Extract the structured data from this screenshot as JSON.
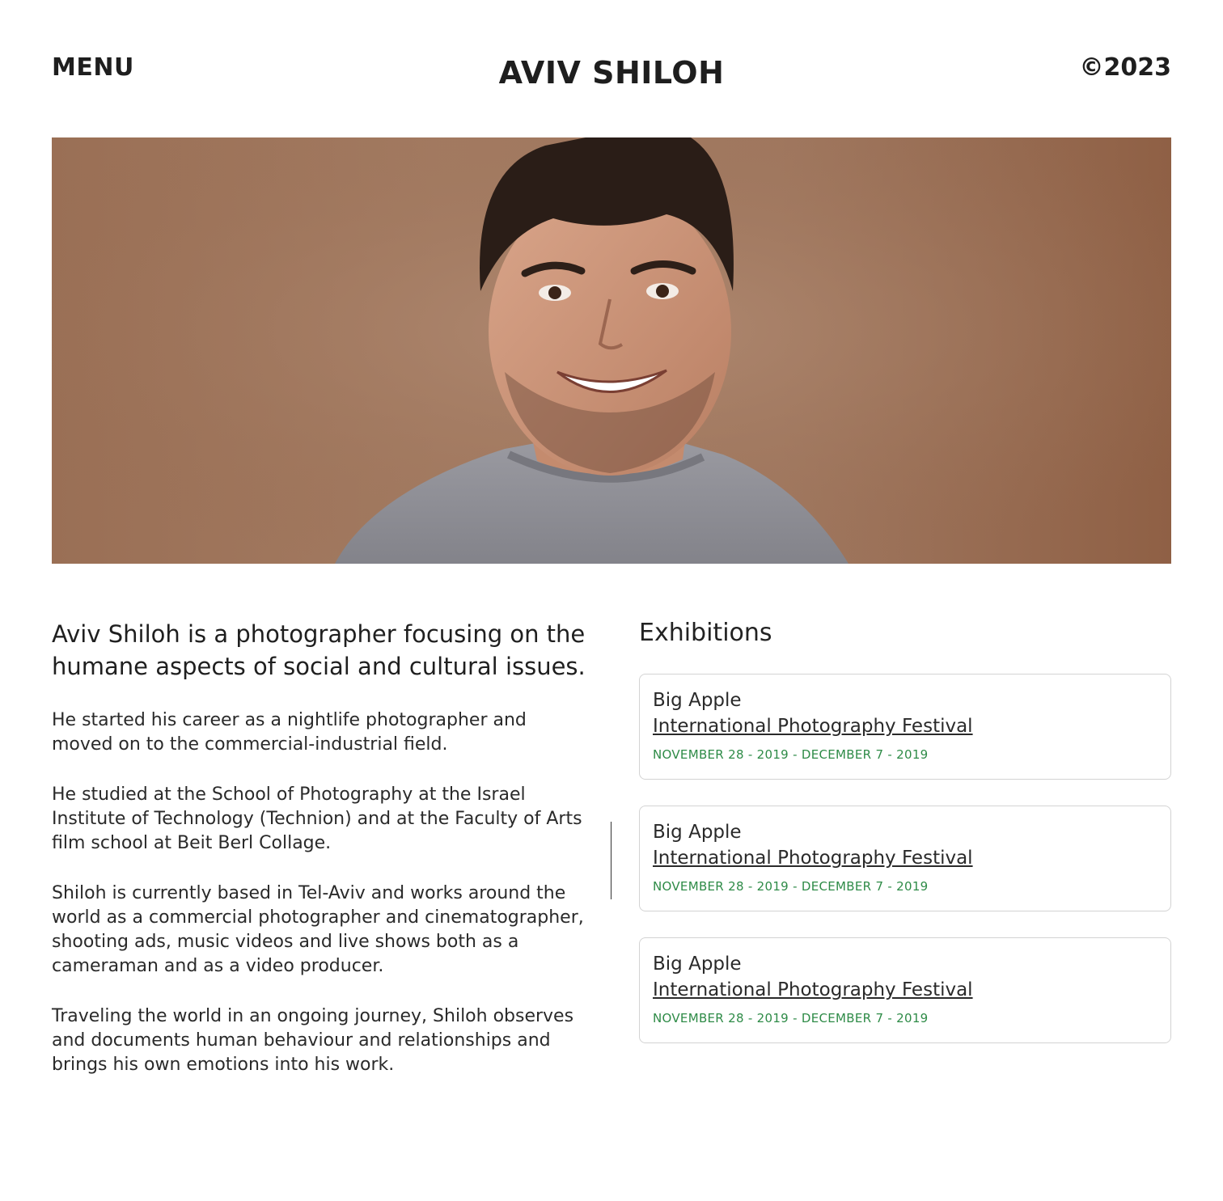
{
  "header": {
    "menu_label": "MENU",
    "title": "AVIV SHILOH",
    "copyright": "©2023"
  },
  "hero": {
    "image_icon": "portrait-photo",
    "background_color": "#9a6f55",
    "shirt_color": "#8f8f95"
  },
  "bio": {
    "lead": "Aviv Shiloh is a photographer focusing on the humane aspects of social and cultural issues.",
    "paragraphs": [
      "He started his career as a nightlife photographer and moved on to the commercial-industrial field.",
      "He studied at the School of Photography at the Israel Institute of Technology (Technion) and at the Faculty of Arts film school at Beit Berl Collage.",
      "Shiloh is currently based in Tel-Aviv and works around the world as a commercial photographer and cinematographer, shooting ads, music videos and live shows both as a cameraman and as a video producer.",
      "Traveling the world in an ongoing journey, Shiloh observes and documents human behaviour and relationships and brings his own emotions into his work."
    ]
  },
  "exhibitions": {
    "heading": "Exhibitions",
    "accent_color": "#2e8b47",
    "items": [
      {
        "name": "Big Apple",
        "link": "International Photography Festival",
        "dates": "NOVEMBER 28 - 2019 - DECEMBER 7 - 2019"
      },
      {
        "name": "Big Apple",
        "link": "International Photography Festival",
        "dates": "NOVEMBER 28 - 2019 - DECEMBER 7 - 2019"
      },
      {
        "name": "Big Apple",
        "link": "International Photography Festival",
        "dates": "NOVEMBER 28 - 2019 - DECEMBER 7 - 2019"
      }
    ]
  }
}
